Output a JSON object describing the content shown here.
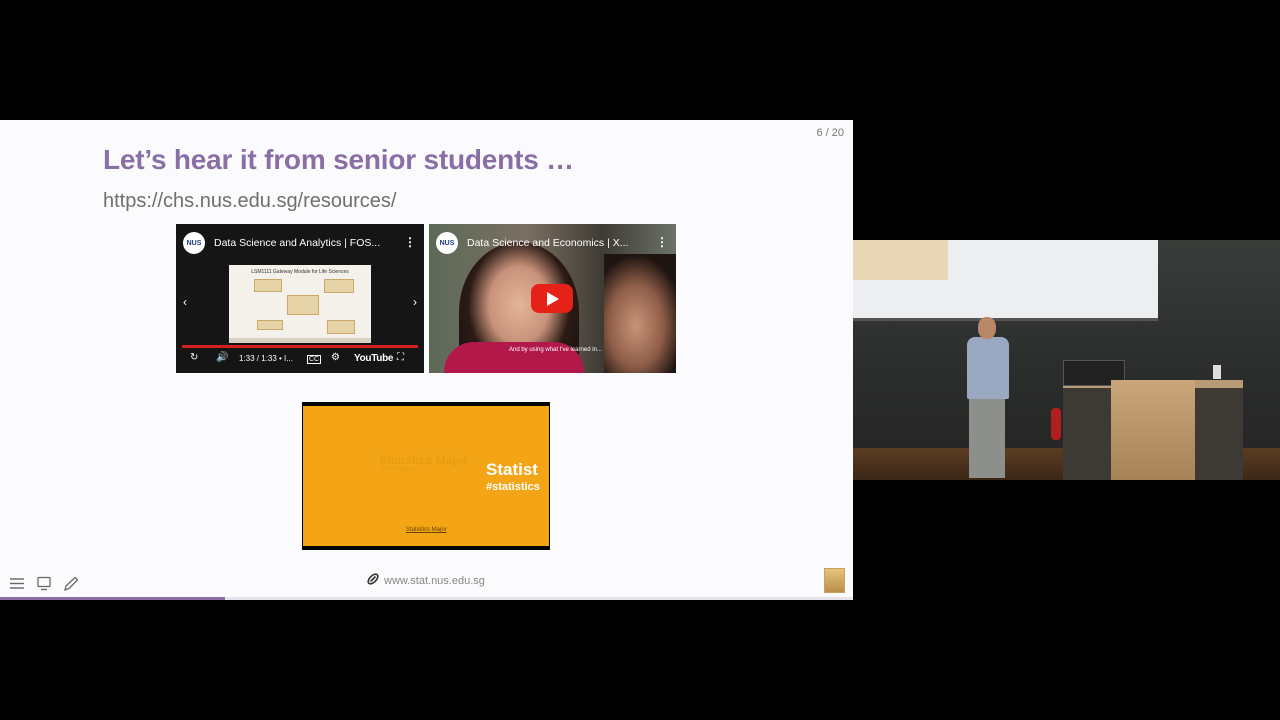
{
  "slide": {
    "counter": "6 / 20",
    "title": "Let’s hear it from senior students …",
    "link": "https://chs.nus.edu.sg/resources/",
    "footer_url": "www.stat.nus.edu.sg",
    "progress_fraction": 0.264
  },
  "videos": [
    {
      "title": "Data Science and Analytics | FOS...",
      "channel_avatar": "NUS",
      "inner_slide_title": "LSM1111 Gateway Module for Life Sciences",
      "time": "1:33 / 1:33 • I...",
      "brand": "YouTube"
    },
    {
      "title": "Data Science and Economics | X...",
      "channel_avatar": "NUS",
      "caption": "And by using what I've learned in..."
    },
    {
      "faded_title": "Statistics Major",
      "faded_sub": "NUS Statistics",
      "big_text": "Statist",
      "hashtag": "#statistics",
      "bottom_link": "Statistics Major"
    }
  ],
  "icons": {
    "menu": "menu-icon",
    "overview": "overview-icon",
    "pen": "pen-icon",
    "link": "link-icon",
    "more": "more-vert-icon"
  },
  "colors": {
    "accent": "#8a6fa6",
    "youtube_red": "#e62117",
    "video3_bg": "#f3a515"
  }
}
